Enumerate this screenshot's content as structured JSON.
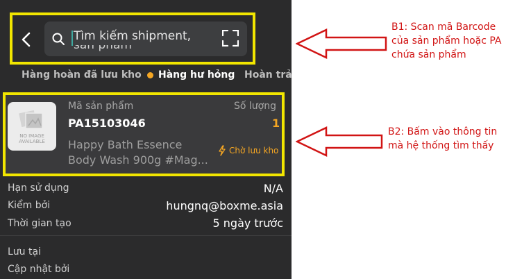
{
  "search": {
    "placeholder_line1": "Tìm kiếm shipment,",
    "placeholder_line2": "sản phẩm"
  },
  "tabs": [
    "Hàng hoàn đã lưu kho",
    "Hàng hư hỏng",
    "Hoàn trả h"
  ],
  "active_tab_index": 1,
  "product": {
    "thumb_text_line1": "NO IMAGE",
    "thumb_text_line2": "AVAILABLE",
    "sku_label": "Mã sản phẩm",
    "sku": "PA15103046",
    "qty_label": "Số lượng",
    "qty": "1",
    "name_line1": "Happy Bath Essence",
    "name_line2": "Body Wash 900g #Mag...",
    "status": "Chờ lưu kho"
  },
  "details": [
    {
      "label": "Hạn sử dụng",
      "value": "N/A"
    },
    {
      "label": "Kiểm bởi",
      "value": "hungnq@boxme.asia"
    },
    {
      "label": "Thời gian tạo",
      "value": "5 ngày trước"
    },
    {
      "label": "Lưu tại",
      "value": ""
    },
    {
      "label": "Cập nhật bởi",
      "value": ""
    }
  ],
  "annotations": {
    "b1_line1": "B1: Scan mã Barcode",
    "b1_line2": "của sản phẩm hoặc PA",
    "b1_line3": "chứa sản phẩm",
    "b2_line1": "B2: Bấm vào thông tin",
    "b2_line2": "mà hệ thống tìm thấy"
  },
  "colors": {
    "highlight": "#f2e600",
    "accent": "#f5a623",
    "annotation": "#d11414",
    "panel": "#2b2b2c"
  },
  "icons": [
    "back-icon",
    "search-icon",
    "scan-icon",
    "image-placeholder-icon",
    "bolt-icon"
  ]
}
